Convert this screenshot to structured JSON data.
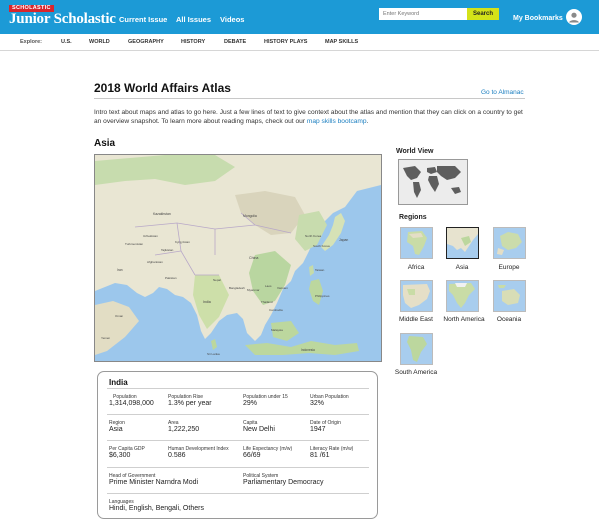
{
  "header": {
    "brand_tag": "SCHOLASTIC",
    "brand_name": "Junior Scholastic",
    "nav": [
      "Current Issue",
      "All Issues",
      "Videos"
    ],
    "search_placeholder": "Enter Keyword",
    "search_button": "Search",
    "bookmarks": "My Bookmarks"
  },
  "explore": {
    "label": "Explore:",
    "items": [
      "U.S.",
      "WORLD",
      "GEOGRAPHY",
      "HISTORY",
      "DEBATE",
      "HISTORY PLAYS",
      "MAP SKILLS"
    ]
  },
  "page": {
    "title": "2018 World Affairs Atlas",
    "almanac_link": "Go to Almanac",
    "intro_before": "Intro text about maps and atlas to go here. Just a few lines of text to give context about the atlas and mention that they can click on a country to get an overview snapshot. To learn more about reading maps, check out our ",
    "intro_link": "map skills bootcamp",
    "intro_after": ".",
    "region_heading": "Asia"
  },
  "map_labels": [
    "Kazakhstan",
    "Mongolia",
    "China",
    "India",
    "Japan",
    "North Korea",
    "South Korea",
    "Thailand",
    "Vietnam",
    "Philippines",
    "Malaysia",
    "Indonesia",
    "Iran",
    "Afghanistan",
    "Pakistan",
    "Turkmenistan",
    "Uzbekistan",
    "Kyrgyzstan",
    "Tajikistan",
    "Nepal",
    "Myanmar",
    "Laos",
    "Cambodia",
    "Sri Lanka",
    "Oman",
    "Yemen",
    "Taiwan",
    "Bangladesh"
  ],
  "sidebar": {
    "world_view": "World View",
    "regions_heading": "Regions",
    "regions": [
      "Africa",
      "Asia",
      "Europe",
      "Middle East",
      "North America",
      "Oceania",
      "South America"
    ]
  },
  "country": {
    "name": "India",
    "population_label": "Population",
    "population": "1,314,098,000",
    "pop_rise_label": "Population Rise",
    "pop_rise": "1.3% per year",
    "under15_label": "Population under 15",
    "under15": "29%",
    "urban_label": "Urban Population",
    "urban": "32%",
    "region_label": "Region",
    "region": "Asia",
    "area_label": "Area",
    "area": "1,222,250",
    "capital_label": "Capita",
    "capital": "New Delhi",
    "origin_label": "Date of Origin",
    "origin": "1947",
    "gdp_label": "Per Capita GDP",
    "gdp": "$6,300",
    "hdi_label": "Human Development Index",
    "hdi": "0.586",
    "life_label": "Life Expectancy (m/w)",
    "life": "66/69",
    "literacy_label": "Literacy Rate (m/w)",
    "literacy": "81 /61",
    "head_label": "Head of Government",
    "head": "Prime Minister Narndra Modi",
    "system_label": "Political System",
    "system": "Parliamentary Democracy",
    "languages_label": "Languages",
    "languages": "Hindi, English, Bengali, Others"
  },
  "colors": {
    "header_bg": "#1c9ad6",
    "search_button": "#d4e219",
    "logo_tag": "#d7262d",
    "link": "#1c7fc0",
    "water": "#9cc7ec",
    "land": "#e9e6d3",
    "land_green": "#b9d6a0"
  }
}
